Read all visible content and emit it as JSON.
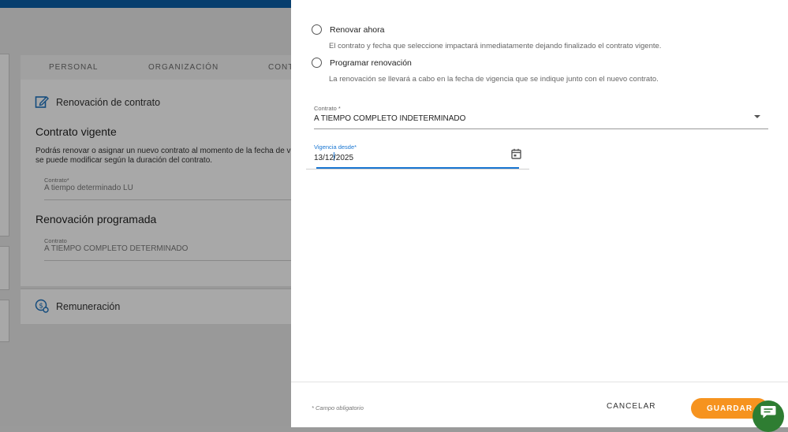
{
  "background": {
    "tabs": [
      "PERSONAL",
      "ORGANIZACIÓN",
      "CONT"
    ],
    "renewal_title": "Renovación de contrato",
    "current_heading": "Contrato vigente",
    "current_text_1": "Podrás renovar o asignar un nuevo contrato al momento de la fecha de ven",
    "current_text_2": "se puede modificar según la duración del contrato.",
    "current_label": "Contrato*",
    "current_value": "A tiempo determinado LU",
    "scheduled_heading": "Renovación programada",
    "scheduled_label": "Contrato",
    "scheduled_value": "A TIEMPO COMPLETO DETERMINADO",
    "remuneration_title": "Remuneración"
  },
  "drawer": {
    "options": [
      {
        "label": "Renovar ahora",
        "description": "El contrato y fecha que seleccione impactará inmediatamente dejando finalizado el contrato vigente."
      },
      {
        "label": "Programar renovación",
        "description": "La renovación se llevará a cabo en la fecha de vigencia que se indique junto con el nuevo contrato."
      }
    ],
    "contract_field": {
      "label": "Contrato *",
      "value": "A TIEMPO COMPLETO INDETERMINADO"
    },
    "date_field": {
      "label": "Vigencia desde*",
      "value_before_caret": "13/12",
      "value_after_caret": "/2025"
    },
    "footer_note": "* Campo obligatorio",
    "cancel_label": "CANCELAR",
    "save_label": "GUARDAR"
  },
  "colors": {
    "accent_blue": "#1976d2",
    "save_orange": "#f6931f",
    "chat_green": "#2e7d32",
    "top_bar": "#0a5fa8"
  },
  "icons": [
    "edit-document-icon",
    "money-gear-icon",
    "calendar-icon",
    "select-arrow-icon",
    "chat-icon"
  ]
}
